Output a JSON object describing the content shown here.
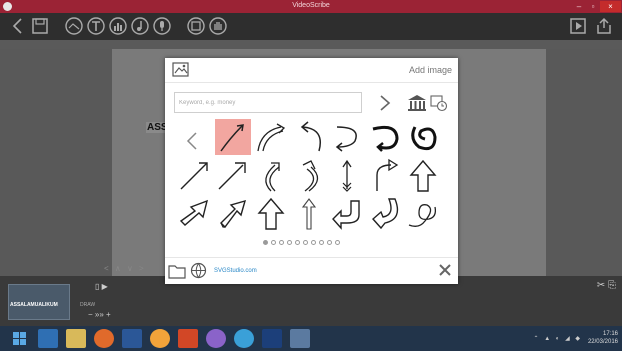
{
  "window": {
    "title": "VideoScribe",
    "minimize_label": "–",
    "restore_label": "▫",
    "close_label": "×"
  },
  "toolbar": {
    "back": "back-icon",
    "save": "save-icon",
    "tools": [
      "image-icon",
      "text-icon",
      "chart-icon",
      "music-icon",
      "voice-icon",
      "background-icon",
      "hand-icon"
    ],
    "preview": "play-icon",
    "share": "share-icon"
  },
  "canvas": {
    "visible_text": "ASS",
    "nav_text": "< ∧ ∨ >"
  },
  "modal": {
    "title": "Add image",
    "search_placeholder": "Keyword, e.g. money",
    "search_value": "",
    "footer_link": "SVGStudio.com",
    "selected_index": 0,
    "images": [
      "arrow-straight",
      "arrow-double-curve",
      "arrow-hook-left",
      "arrow-hook-right",
      "arrow-loop-left",
      "arrow-loop-right",
      "arrow-diagonal-thin",
      "arrow-diagonal-outline",
      "arrow-curve-up",
      "arrow-curve-s",
      "arrow-feathered",
      "arrow-bent-up",
      "arrow-block-diagonal",
      "arrow-block-3d",
      "arrow-block-up",
      "arrow-thin-up",
      "arrow-uturn-block",
      "arrow-uturn-curl",
      "arrow-swirl"
    ],
    "pages": 10,
    "current_page": 1
  },
  "timeline": {
    "scene_label": "ASSALAMUALIKUM",
    "scene_label2": "DRAW"
  },
  "taskbar": {
    "time": "17:16",
    "date": "22/03/2016"
  },
  "colors": {
    "titlebar": "#9b2335",
    "selected_cell": "#f2a6a0",
    "link": "#2a88c7"
  }
}
